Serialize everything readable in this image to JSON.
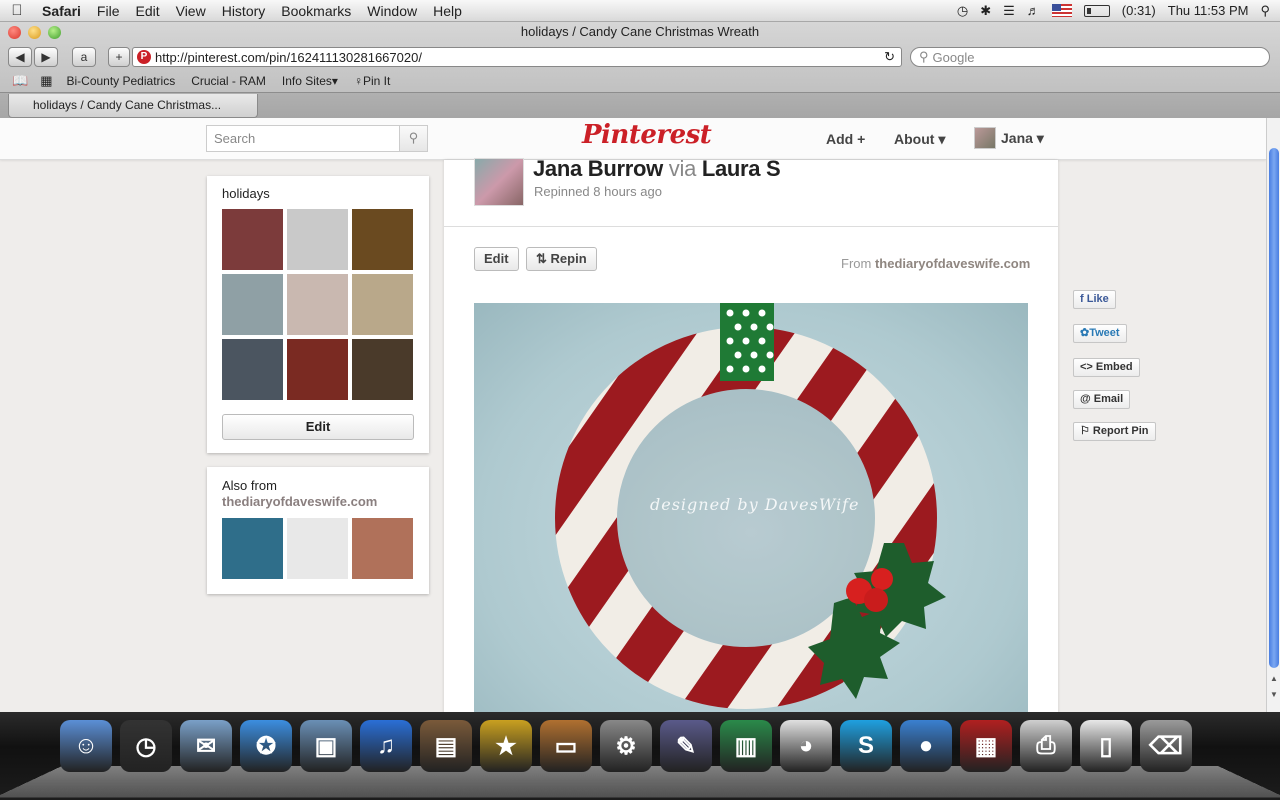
{
  "menubar": {
    "apple": "",
    "items": [
      "Safari",
      "File",
      "Edit",
      "View",
      "History",
      "Bookmarks",
      "Window",
      "Help"
    ],
    "battery": "(0:31)",
    "clock": "Thu 11:53 PM"
  },
  "browser": {
    "window_title": "holidays / Candy Cane Christmas Wreath",
    "url": "http://pinterest.com/pin/162411130281667020/",
    "search_placeholder": "Google",
    "bookmarks": [
      "Bi-County Pediatrics",
      "Crucial - RAM",
      "Info Sites▾",
      "♀Pin It"
    ],
    "tab_title": "holidays / Candy Cane Christmas..."
  },
  "pinterest": {
    "search_placeholder": "Search",
    "logo": "Pinterest",
    "nav": {
      "add": "Add +",
      "about": "About ▾",
      "user": "Jana ▾"
    },
    "board": {
      "name": "holidays",
      "edit_label": "Edit",
      "thumb_colors": [
        "#7c3b3b",
        "#c9c9c9",
        "#6a4a20",
        "#8fa0a5",
        "#c9b8b0",
        "#b9a88a",
        "#4b5560",
        "#7a2a22",
        "#4a3a2a"
      ]
    },
    "also_from": {
      "title": "Also from",
      "source": "thediaryofdaveswife.com",
      "thumb_colors": [
        "#2f6e8a",
        "#e8e8e8",
        "#b0715a"
      ]
    },
    "pin": {
      "pinner": "Jana Burrow",
      "via": "via",
      "source_user": "Laura S",
      "time": "Repinned 8 hours ago",
      "edit_label": "Edit",
      "repin_label": "Repin",
      "from_label": "From",
      "from_domain": "thediaryofdaveswife.com",
      "watermark": "designed by DavesWife"
    },
    "share": {
      "like": "Like",
      "tweet": "Tweet",
      "embed": "<> Embed",
      "email": "@ Email",
      "report": "⚐ Report Pin"
    }
  },
  "dock": {
    "icons": [
      {
        "name": "finder-icon",
        "color": "#5b8fd6",
        "glyph": "☺"
      },
      {
        "name": "dashboard-icon",
        "color": "#333",
        "glyph": "◷"
      },
      {
        "name": "mail-icon",
        "color": "#7aa0c8",
        "glyph": "✉"
      },
      {
        "name": "safari-icon",
        "color": "#3c8ee0",
        "glyph": "✪"
      },
      {
        "name": "iphoto-icon",
        "color": "#6a8fb5",
        "glyph": "▣"
      },
      {
        "name": "itunes-icon",
        "color": "#2a6fd6",
        "glyph": "♫"
      },
      {
        "name": "image-capture-icon",
        "color": "#7a5a3a",
        "glyph": "▤"
      },
      {
        "name": "imovie-icon",
        "color": "#c9a020",
        "glyph": "★"
      },
      {
        "name": "keynote-icon",
        "color": "#b07030",
        "glyph": "▭"
      },
      {
        "name": "system-preferences-icon",
        "color": "#888",
        "glyph": "⚙"
      },
      {
        "name": "pen-icon",
        "color": "#5a5a8a",
        "glyph": "✎"
      },
      {
        "name": "numbers-icon",
        "color": "#2a8a4a",
        "glyph": "▥"
      },
      {
        "name": "picasa-icon",
        "color": "#e0e0e0",
        "glyph": "◕"
      },
      {
        "name": "skype-icon",
        "color": "#1fa0e0",
        "glyph": "S"
      },
      {
        "name": "ichat-icon",
        "color": "#3a80d0",
        "glyph": "●"
      },
      {
        "name": "photo-booth-icon",
        "color": "#b02020",
        "glyph": "▦"
      },
      {
        "name": "printer-icon",
        "color": "#cfcfcf",
        "glyph": "⎙"
      },
      {
        "name": "documents-icon",
        "color": "#e8e8e8",
        "glyph": "▯"
      },
      {
        "name": "trash-icon",
        "color": "#9a9a9a",
        "glyph": "⌫"
      }
    ]
  }
}
